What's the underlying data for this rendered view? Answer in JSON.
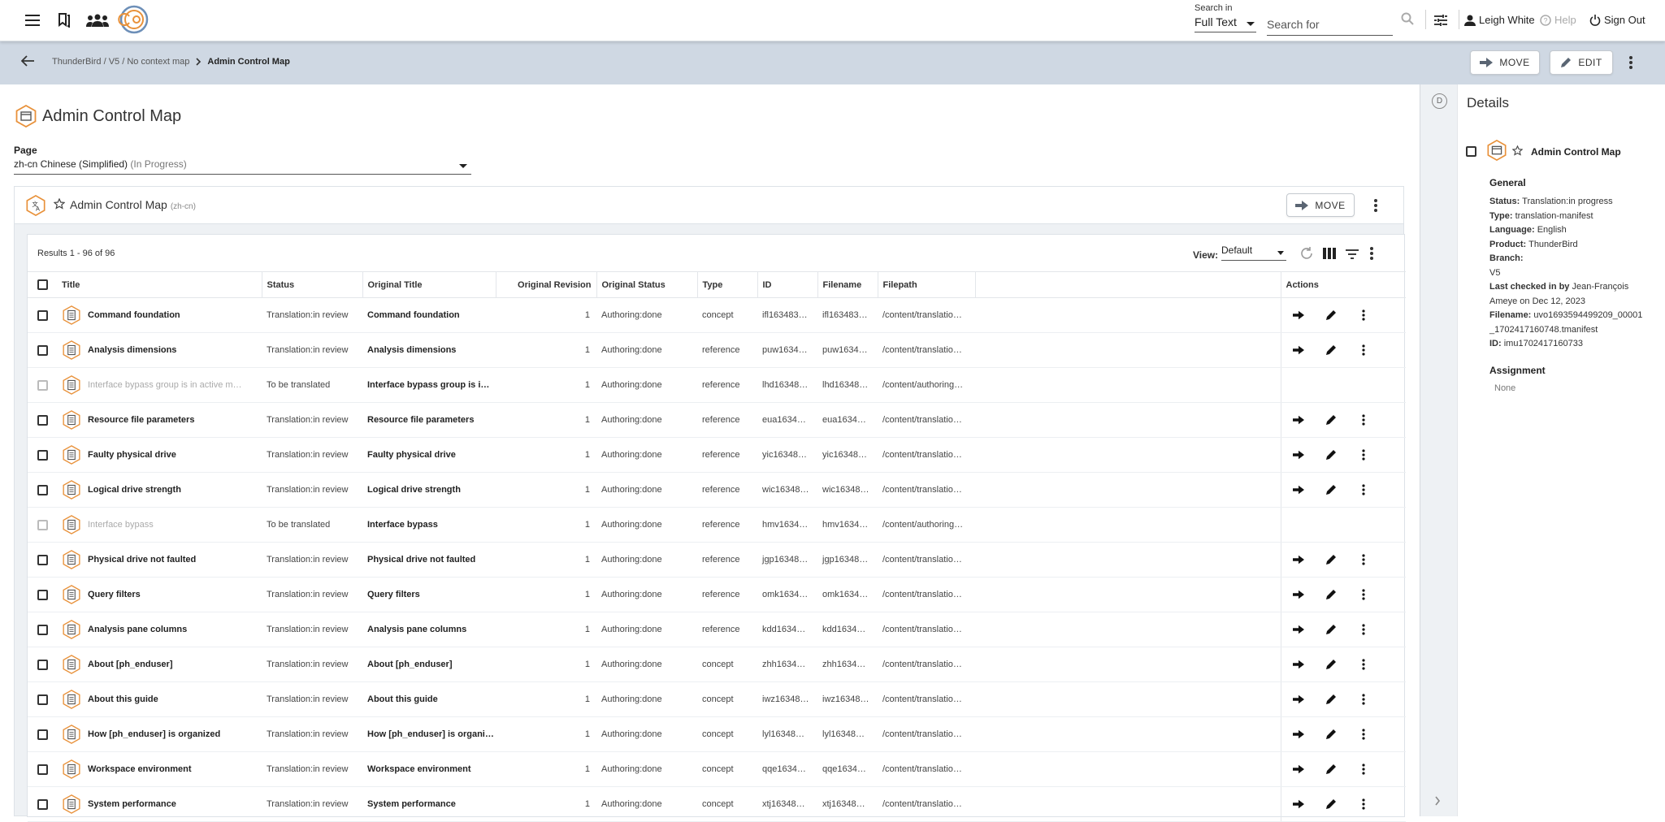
{
  "topbar": {
    "search_in_label": "Search in",
    "search_in_value": "Full Text",
    "search_placeholder": "Search for",
    "user": "Leigh White",
    "help": "Help",
    "signout": "Sign Out"
  },
  "breadcrumb": {
    "path": "ThunderBird / V5 / No context map",
    "current": "Admin Control Map",
    "move": "MOVE",
    "edit": "EDIT"
  },
  "page": {
    "title": "Admin Control Map",
    "page_label": "Page",
    "page_value": "zh-cn Chinese (Simplified)",
    "page_status": "(In Progress)"
  },
  "panel": {
    "title": "Admin Control Map",
    "lang": "(zh-cn)",
    "move": "MOVE"
  },
  "results": {
    "count": "Results 1 - 96 of 96",
    "view_label": "View:",
    "view_value": "Default",
    "columns": [
      "Title",
      "Status",
      "Original Title",
      "Original Revision",
      "Original Status",
      "Type",
      "ID",
      "Filename",
      "Filepath",
      "Actions"
    ],
    "rows": [
      {
        "title": "Command foundation",
        "status": "Translation:in review",
        "otitle": "Command foundation",
        "rev": "1",
        "ostatus": "Authoring:done",
        "type": "concept",
        "id": "ifl163483…",
        "filename": "ifl163483…",
        "filepath": "/content/translatio…",
        "enabled": true
      },
      {
        "title": "Analysis dimensions",
        "status": "Translation:in review",
        "otitle": "Analysis dimensions",
        "rev": "1",
        "ostatus": "Authoring:done",
        "type": "reference",
        "id": "puw1634…",
        "filename": "puw1634…",
        "filepath": "/content/translatio…",
        "enabled": true
      },
      {
        "title": "Interface bypass group is in active m…",
        "status": "To be translated",
        "otitle": "Interface bypass group is i…",
        "rev": "1",
        "ostatus": "Authoring:done",
        "type": "reference",
        "id": "lhd16348…",
        "filename": "lhd16348…",
        "filepath": "/content/authoring…",
        "enabled": false
      },
      {
        "title": "Resource file parameters",
        "status": "Translation:in review",
        "otitle": "Resource file parameters",
        "rev": "1",
        "ostatus": "Authoring:done",
        "type": "reference",
        "id": "eua1634…",
        "filename": "eua1634…",
        "filepath": "/content/translatio…",
        "enabled": true
      },
      {
        "title": "Faulty physical drive",
        "status": "Translation:in review",
        "otitle": "Faulty physical drive",
        "rev": "1",
        "ostatus": "Authoring:done",
        "type": "reference",
        "id": "yic16348…",
        "filename": "yic16348…",
        "filepath": "/content/translatio…",
        "enabled": true
      },
      {
        "title": "Logical drive strength",
        "status": "Translation:in review",
        "otitle": "Logical drive strength",
        "rev": "1",
        "ostatus": "Authoring:done",
        "type": "reference",
        "id": "wic16348…",
        "filename": "wic16348…",
        "filepath": "/content/translatio…",
        "enabled": true
      },
      {
        "title": "Interface bypass",
        "status": "To be translated",
        "otitle": "Interface bypass",
        "rev": "1",
        "ostatus": "Authoring:done",
        "type": "reference",
        "id": "hmv1634…",
        "filename": "hmv1634…",
        "filepath": "/content/authoring…",
        "enabled": false
      },
      {
        "title": "Physical drive not faulted",
        "status": "Translation:in review",
        "otitle": "Physical drive not faulted",
        "rev": "1",
        "ostatus": "Authoring:done",
        "type": "reference",
        "id": "jgp16348…",
        "filename": "jgp16348…",
        "filepath": "/content/translatio…",
        "enabled": true
      },
      {
        "title": "Query filters",
        "status": "Translation:in review",
        "otitle": "Query filters",
        "rev": "1",
        "ostatus": "Authoring:done",
        "type": "reference",
        "id": "omk1634…",
        "filename": "omk1634…",
        "filepath": "/content/translatio…",
        "enabled": true
      },
      {
        "title": "Analysis pane columns",
        "status": "Translation:in review",
        "otitle": "Analysis pane columns",
        "rev": "1",
        "ostatus": "Authoring:done",
        "type": "reference",
        "id": "kdd1634…",
        "filename": "kdd1634…",
        "filepath": "/content/translatio…",
        "enabled": true
      },
      {
        "title": "About [ph_enduser]",
        "status": "Translation:in review",
        "otitle": "About [ph_enduser]",
        "rev": "1",
        "ostatus": "Authoring:done",
        "type": "concept",
        "id": "zhh1634…",
        "filename": "zhh1634…",
        "filepath": "/content/translatio…",
        "enabled": true
      },
      {
        "title": "About this guide",
        "status": "Translation:in review",
        "otitle": "About this guide",
        "rev": "1",
        "ostatus": "Authoring:done",
        "type": "concept",
        "id": "iwz16348…",
        "filename": "iwz16348…",
        "filepath": "/content/translatio…",
        "enabled": true
      },
      {
        "title": "How [ph_enduser] is organized",
        "status": "Translation:in review",
        "otitle": "How [ph_enduser] is organi…",
        "rev": "1",
        "ostatus": "Authoring:done",
        "type": "concept",
        "id": "lyl16348…",
        "filename": "lyl16348…",
        "filepath": "/content/translatio…",
        "enabled": true
      },
      {
        "title": "Workspace environment",
        "status": "Translation:in review",
        "otitle": "Workspace environment",
        "rev": "1",
        "ostatus": "Authoring:done",
        "type": "concept",
        "id": "qqe1634…",
        "filename": "qqe1634…",
        "filepath": "/content/translatio…",
        "enabled": true
      },
      {
        "title": "System performance",
        "status": "Translation:in review",
        "otitle": "System performance",
        "rev": "1",
        "ostatus": "Authoring:done",
        "type": "concept",
        "id": "xtj16348…",
        "filename": "xtj16348…",
        "filepath": "/content/translatio…",
        "enabled": true
      }
    ]
  },
  "details": {
    "rail_letter": "D",
    "title": "Details",
    "item_title": "Admin Control Map",
    "general": "General",
    "fields": [
      {
        "k": "Status:",
        "v": "Translation:in progress"
      },
      {
        "k": "Type:",
        "v": "translation-manifest"
      },
      {
        "k": "Language:",
        "v": "English"
      },
      {
        "k": "Product:",
        "v": "ThunderBird"
      },
      {
        "k": "Branch:",
        "v": ""
      }
    ],
    "branch_value": "V5",
    "checked_label": "Last checked in by",
    "checked_value": "Jean-François",
    "checked_value2": "Ameye on Dec 12, 2023",
    "filename_label": "Filename:",
    "filename_value": "uvo1693594499209_00001",
    "filename_value2": "_1702417160748.tmanifest",
    "id_label": "ID:",
    "id_value": "imu1702417160733",
    "assignment": "Assignment",
    "assignment_value": "None"
  },
  "colors": {
    "accent": "#e8913a",
    "crumbbar": "#cfd8e3",
    "rail": "#eef1f4"
  }
}
